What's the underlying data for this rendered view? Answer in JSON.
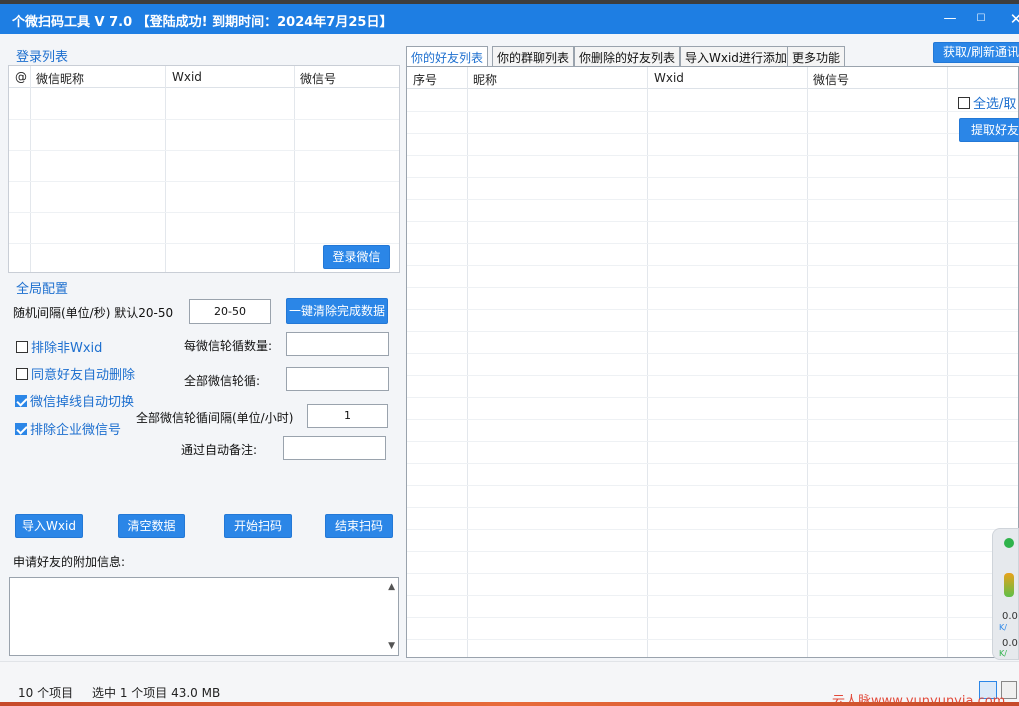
{
  "window": {
    "title": "个微扫码工具 V 7.0  【登陆成功! 到期时间：2024年7月25日】",
    "minimize": "—",
    "maximize": "☐",
    "close": "✕"
  },
  "login_list": {
    "section_title": "登录列表",
    "columns": [
      "@",
      "微信昵称",
      "Wxid",
      "微信号"
    ],
    "login_button": "登录微信"
  },
  "global_config": {
    "section_title": "全局配置",
    "interval_label": "随机间隔(单位/秒) 默认20-50",
    "interval_value": "20-50",
    "clear_done_button": "一键清除完成数据",
    "exclude_non_wxid": "排除非Wxid",
    "exclude_non_wxid_checked": false,
    "auto_delete_label": "同意好友自动删除",
    "auto_delete_checked": false,
    "auto_switch_label": "微信掉线自动切换",
    "auto_switch_checked": true,
    "exclude_enterprise_label": "排除企业微信号",
    "exclude_enterprise_checked": true,
    "per_wechat_rounds_label": "每微信轮循数量:",
    "per_wechat_rounds_value": "",
    "all_rounds_label": "全部微信轮循:",
    "all_rounds_value": "",
    "round_interval_label": "全部微信轮循间隔(单位/小时)",
    "round_interval_value": "1",
    "auto_remark_label": "通过自动备注:",
    "auto_remark_value": ""
  },
  "actions": {
    "import_wxid": "导入Wxid",
    "clear_data": "清空数据",
    "start_scan": "开始扫码",
    "stop_scan": "结束扫码"
  },
  "friend_request": {
    "label": "申请好友的附加信息:",
    "value": ""
  },
  "tabs": [
    "你的好友列表",
    "你的群聊列表",
    "你删除的好友列表",
    "导入Wxid进行添加",
    "更多功能"
  ],
  "friend_table": {
    "columns": [
      "序号",
      "昵称",
      "Wxid",
      "微信号"
    ]
  },
  "right_controls": {
    "refresh_button": "获取/刷新通讯",
    "select_all": "全选/取",
    "extract_button": "提取好友"
  },
  "statusbar": {
    "items_count": "10 个项目",
    "selected": "选中 1 个项目  43.0 MB"
  },
  "widget": {
    "upload_value": "0.0",
    "upload_unit": "K/",
    "download_value": "0.0",
    "download_unit": "K/"
  },
  "watermark": "云人脉www.yunyunyia.com",
  "colors": {
    "accent": "#1e7ee3",
    "button": "#2b86e7",
    "section_title": "#1d6fcf",
    "watermark": "#e24a3a"
  }
}
